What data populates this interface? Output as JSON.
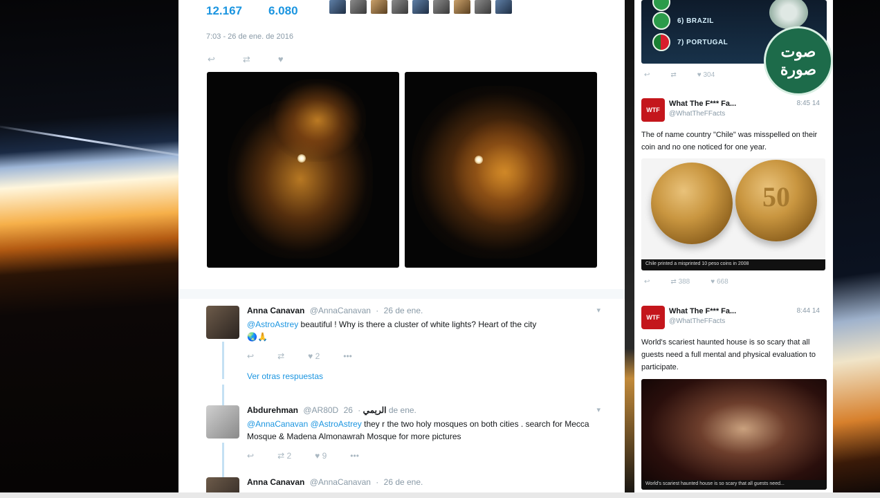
{
  "tweet": {
    "retweets": "12.167",
    "likes": "6.080",
    "timestamp": "7:03 - 26 de ene. de 2016"
  },
  "replies": [
    {
      "name": "Anna Canavan",
      "handle": "@AnnaCanavan",
      "time": "26 de ene.",
      "mention": "@AstroAstrey",
      "text": " beautiful ! Why is there a cluster of white lights? Heart of the city",
      "emoji": "🌏🙏",
      "reply_count": "",
      "retweet_count": "",
      "like_count": "2"
    },
    {
      "name": "Abdurehman",
      "handle": "@AR80D",
      "arabic_name": "الريمي",
      "time": "26 de ene.",
      "mention": "@AnnaCanavan @AstroAstrey",
      "text": " they r the two holy mosques on both cities . search for Mecca Mosque & Madena Almonawrah Mosque for more pictures",
      "reply_count": "",
      "retweet_count": "2",
      "like_count": "9"
    },
    {
      "name": "Anna Canavan",
      "handle": "@AnnaCanavan",
      "time": "26 de ene."
    }
  ],
  "more_replies_label": "Ver otras respuestas",
  "feed": {
    "countries": [
      {
        "rank_label": "",
        "name": ""
      },
      {
        "rank_label": "",
        "name": "6) BRAZIL"
      },
      {
        "rank_label": "",
        "name": "7) PORTUGAL"
      }
    ],
    "top_counts": {
      "retweets": "",
      "likes": "304"
    },
    "logo_line1": "صوت",
    "logo_line2": "صورة",
    "cards": [
      {
        "name": "What The F*** Fa...",
        "handle": "@WhatTheFFacts",
        "time": "8:45 14",
        "text": "The of name country \"Chile\" was misspelled on their coin and no one noticed for one year.",
        "image_caption": "Chile printed a misprinted 10 peso coins in 2008",
        "retweets": "388",
        "likes": "668",
        "coin_value": "50"
      },
      {
        "name": "What The F*** Fa...",
        "handle": "@WhatTheFFacts",
        "time": "8:44 14",
        "text": "World's scariest haunted house is so scary that all guests need a full mental and physical evaluation to participate.",
        "image_caption": "World's scariest haunted house is so scary that all guests need..."
      }
    ],
    "avatar_label": "WTF"
  },
  "colors": {
    "link": "#1b95e0",
    "muted": "#8899a6",
    "brand_green": "#1d6b4a",
    "wtf_red": "#c4161c"
  },
  "icons": [
    "reply-icon",
    "retweet-icon",
    "like-icon",
    "more-icon",
    "caret-down-icon"
  ]
}
